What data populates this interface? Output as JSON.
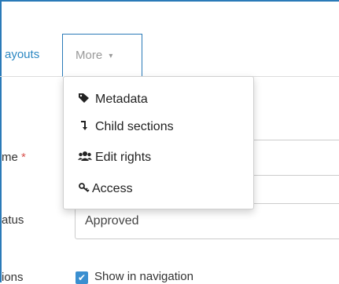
{
  "tabs": {
    "layouts_label": "ayouts",
    "more_label": "More",
    "more_caret": "▾"
  },
  "dropdown": {
    "items": [
      {
        "label": "Metadata",
        "icon": "tags-icon",
        "glyph": "🏷"
      },
      {
        "label": "Child sections",
        "icon": "child-arrow-icon",
        "glyph": "↴"
      },
      {
        "label": "Edit rights",
        "icon": "users-icon",
        "glyph": "👥"
      },
      {
        "label": "Access",
        "icon": "key-icon",
        "glyph": "🔑"
      }
    ]
  },
  "form": {
    "name_label": "me",
    "required_marker": "*",
    "status_label": "atus",
    "status_value": "Approved",
    "options_label": "ions",
    "show_in_nav_label": "Show in navigation",
    "checkbox_mark": "✔"
  },
  "colors": {
    "accent": "#2a7ab8",
    "link": "#2b87c2",
    "required": "#d9534f"
  }
}
